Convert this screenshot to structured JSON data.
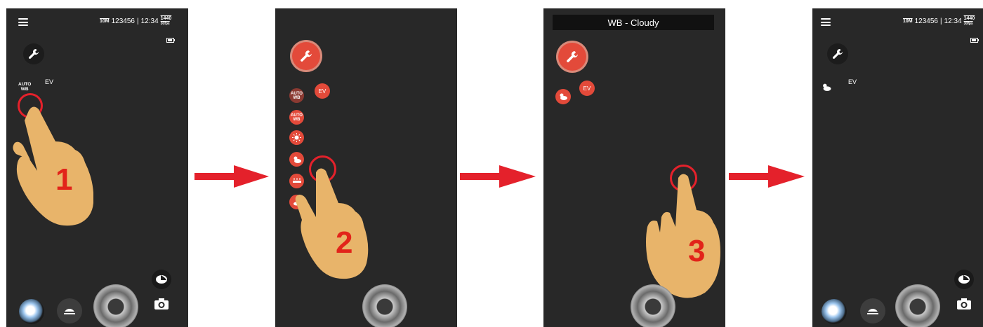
{
  "status": {
    "resolution": "10M",
    "count": "123456",
    "separator": "|",
    "time": "12:34",
    "quality_top": "1440",
    "quality_bottom": "30fps"
  },
  "panel1": {
    "autowb_line1": "AUTO",
    "autowb_line2": "WB",
    "ev_label": "EV",
    "step": "1"
  },
  "panel2": {
    "ev_label": "EV",
    "options": [
      {
        "line1": "AUTO",
        "line2": "WB"
      },
      {
        "line1": "AUTO",
        "line2": "WB"
      },
      {
        "icon": "sun-icon"
      },
      {
        "icon": "cloudy-icon"
      },
      {
        "icon": "fluorescent-icon"
      },
      {
        "icon": "underwater-icon"
      }
    ],
    "step": "2"
  },
  "panel3": {
    "banner": "WB - Cloudy",
    "ev_label": "EV",
    "step": "3"
  },
  "panel4": {
    "ev_label": "EV"
  },
  "colors": {
    "accent": "#e34a3a",
    "ring": "#e4212b",
    "arrow": "#e4212b",
    "screen": "#282828",
    "hand": "#e8b46a"
  }
}
